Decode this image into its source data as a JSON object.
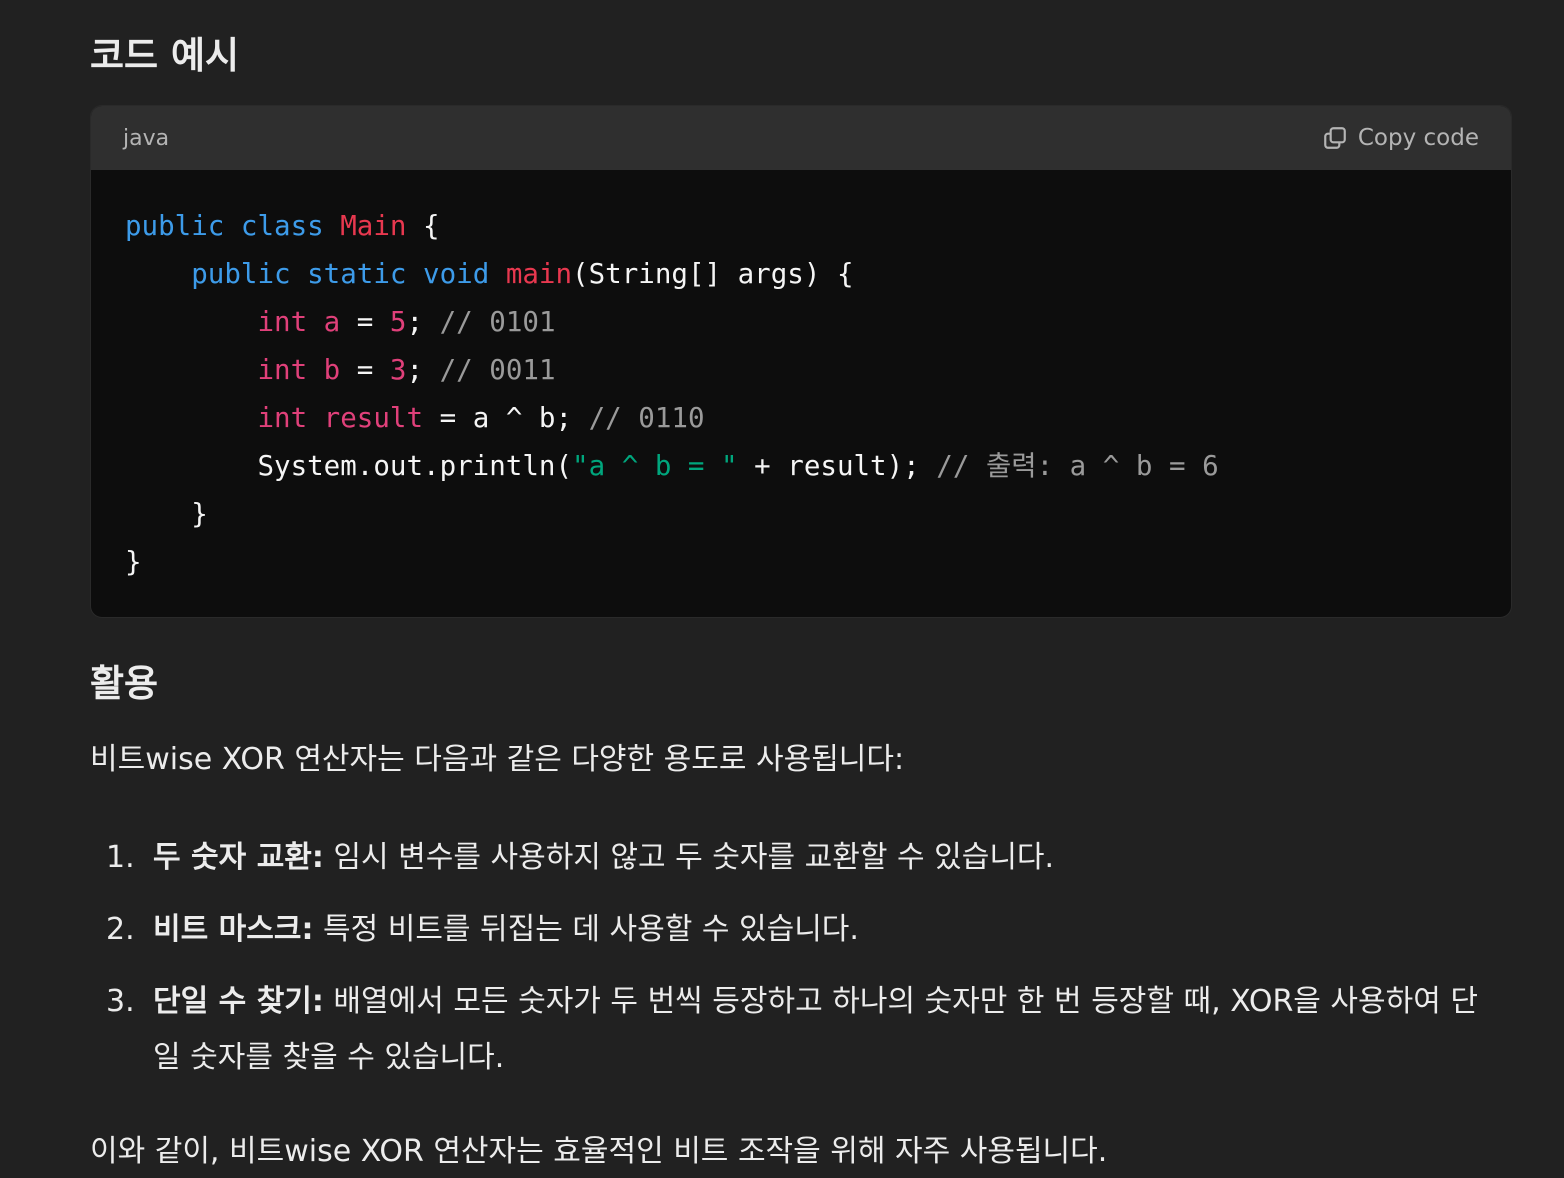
{
  "headings": {
    "code_example": "코드 예시",
    "usage": "활용"
  },
  "code_block": {
    "language": "java",
    "copy_label": "Copy code",
    "copy_icon": "copy-icon",
    "lines": [
      [
        {
          "t": "public class ",
          "c": "kw"
        },
        {
          "t": "Main",
          "c": "cls"
        },
        {
          "t": " {",
          "c": ""
        }
      ],
      [
        {
          "t": "    ",
          "c": ""
        },
        {
          "t": "public static void ",
          "c": "kw"
        },
        {
          "t": "main",
          "c": "fn"
        },
        {
          "t": "(String[] args) {",
          "c": ""
        }
      ],
      [
        {
          "t": "        ",
          "c": ""
        },
        {
          "t": "int a",
          "c": "ty"
        },
        {
          "t": " = ",
          "c": ""
        },
        {
          "t": "5",
          "c": "num"
        },
        {
          "t": "; ",
          "c": ""
        },
        {
          "t": "// 0101",
          "c": "cm"
        }
      ],
      [
        {
          "t": "        ",
          "c": ""
        },
        {
          "t": "int b",
          "c": "ty"
        },
        {
          "t": " = ",
          "c": ""
        },
        {
          "t": "3",
          "c": "num"
        },
        {
          "t": "; ",
          "c": ""
        },
        {
          "t": "// 0011",
          "c": "cm"
        }
      ],
      [
        {
          "t": "        ",
          "c": ""
        },
        {
          "t": "int result",
          "c": "ty"
        },
        {
          "t": " = a ^ b; ",
          "c": ""
        },
        {
          "t": "// 0110",
          "c": "cm"
        }
      ],
      [
        {
          "t": "        System.out.println(",
          "c": ""
        },
        {
          "t": "\"a ^ b = \"",
          "c": "str"
        },
        {
          "t": " + result); ",
          "c": ""
        },
        {
          "t": "// 출력: a ^ b = 6",
          "c": "cm"
        }
      ],
      [
        {
          "t": "    }",
          "c": ""
        }
      ],
      [
        {
          "t": "}",
          "c": ""
        }
      ]
    ]
  },
  "intro": "비트wise XOR 연산자는 다음과 같은 다양한 용도로 사용됩니다:",
  "uses": [
    {
      "num": "1.",
      "title": "두 숫자 교환:",
      "text": " 임시 변수를 사용하지 않고 두 숫자를 교환할 수 있습니다."
    },
    {
      "num": "2.",
      "title": "비트 마스크:",
      "text": " 특정 비트를 뒤집는 데 사용할 수 있습니다."
    },
    {
      "num": "3.",
      "title": "단일 수 찾기:",
      "text": " 배열에서 모든 숫자가 두 번씩 등장하고 하나의 숫자만 한 번 등장할 때, XOR을 사용하여 단일 숫자를 찾을 수 있습니다."
    }
  ],
  "conclusion": "이와 같이, 비트wise XOR 연산자는 효율적인 비트 조작을 위해 자주 사용됩니다."
}
